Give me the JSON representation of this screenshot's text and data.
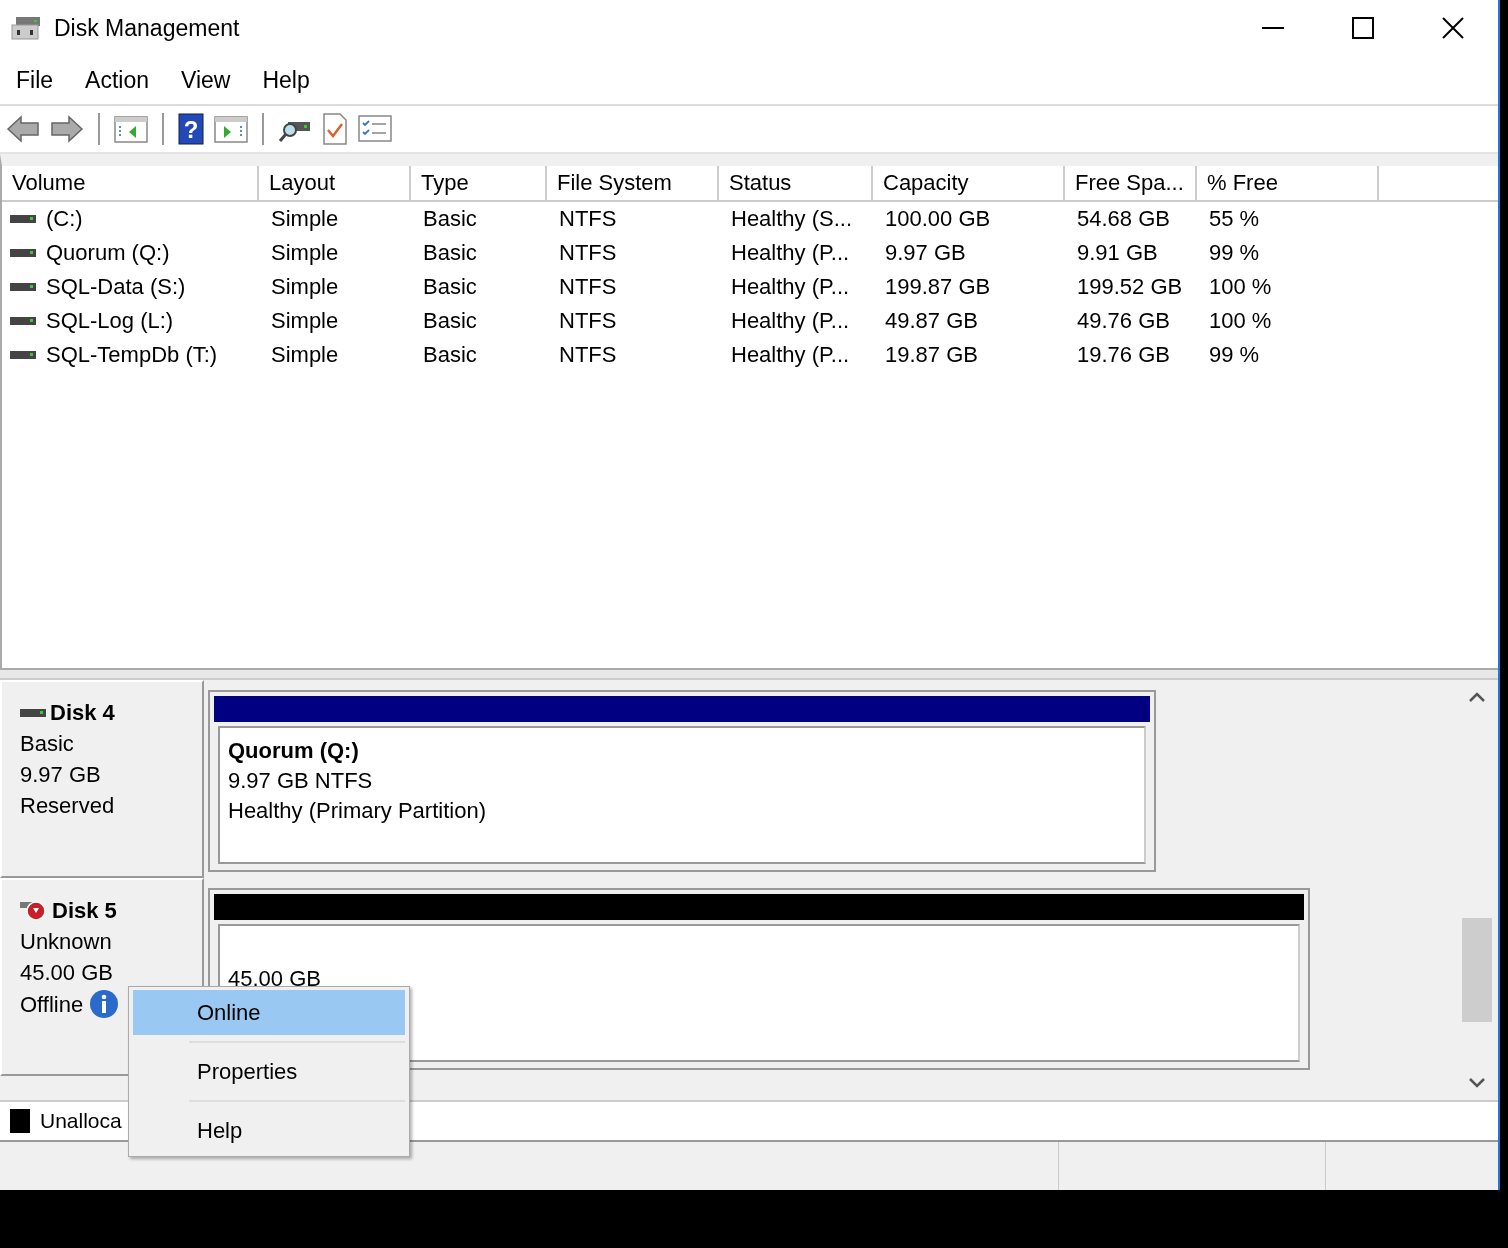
{
  "window": {
    "title": "Disk Management"
  },
  "menu": [
    "File",
    "Action",
    "View",
    "Help"
  ],
  "toolbar": {
    "help_glyph": "?"
  },
  "volume_list": {
    "columns": [
      "Volume",
      "Layout",
      "Type",
      "File System",
      "Status",
      "Capacity",
      "Free Spa...",
      "% Free"
    ],
    "rows": [
      [
        "(C:)",
        "Simple",
        "Basic",
        "NTFS",
        "Healthy (S...",
        "100.00 GB",
        "54.68 GB",
        "55 %"
      ],
      [
        "Quorum (Q:)",
        "Simple",
        "Basic",
        "NTFS",
        "Healthy (P...",
        "9.97 GB",
        "9.91 GB",
        "99 %"
      ],
      [
        "SQL-Data (S:)",
        "Simple",
        "Basic",
        "NTFS",
        "Healthy (P...",
        "199.87 GB",
        "199.52 GB",
        "100 %"
      ],
      [
        "SQL-Log (L:)",
        "Simple",
        "Basic",
        "NTFS",
        "Healthy (P...",
        "49.87 GB",
        "49.76 GB",
        "100 %"
      ],
      [
        "SQL-TempDb (T:)",
        "Simple",
        "Basic",
        "NTFS",
        "Healthy (P...",
        "19.87 GB",
        "19.76 GB",
        "99 %"
      ]
    ]
  },
  "disks": [
    {
      "name": "Disk 4",
      "kind": "online",
      "type": "Basic",
      "size": "9.97 GB",
      "status": "Reserved",
      "color": "#000080",
      "partition": {
        "title": "Quorum  (Q:)",
        "lines": [
          "9.97 GB NTFS",
          "Healthy (Primary Partition)"
        ]
      }
    },
    {
      "name": "Disk 5",
      "kind": "offline",
      "type": "Unknown",
      "size": "45.00 GB",
      "status": "Offline",
      "color": "#000000",
      "partition": {
        "lines": [
          "45.00 GB"
        ]
      }
    }
  ],
  "legend": [
    {
      "label": "Unalloca",
      "color": "#000000"
    }
  ],
  "context_menu": [
    {
      "label": "Online",
      "selected": true
    },
    {
      "label": "Properties",
      "selected": false
    },
    {
      "label": "Help",
      "selected": false
    }
  ]
}
